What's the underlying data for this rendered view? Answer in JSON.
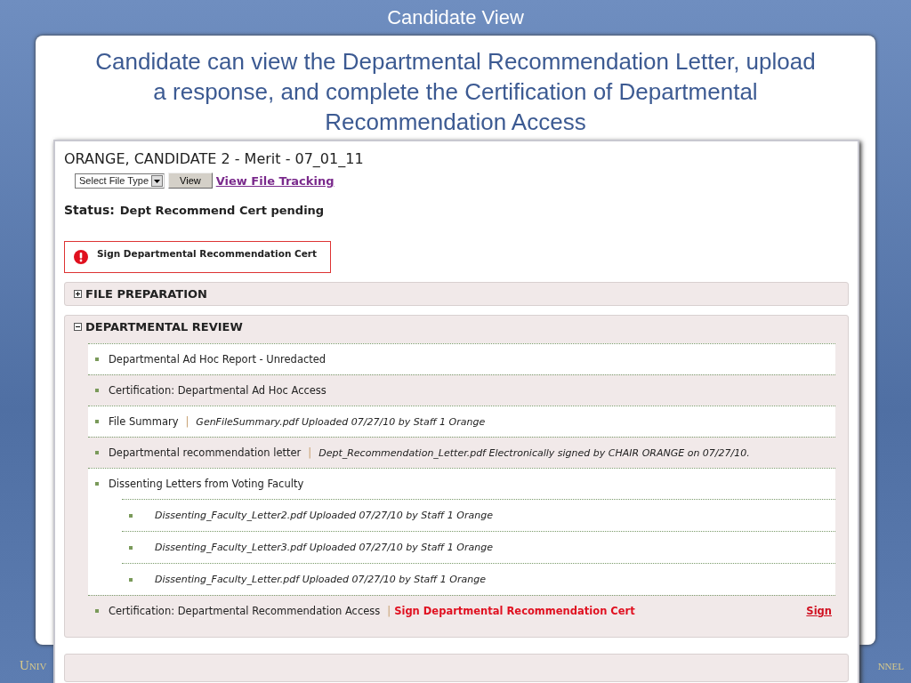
{
  "slide": {
    "title": "Candidate View",
    "heading": "Candidate can view the Departmental Recommendation Letter, upload a response, and complete the Certification of Departmental Recommendation Access",
    "footer_left": "Univ",
    "footer_right": "nnel"
  },
  "screenshot": {
    "title": "ORANGE, CANDIDATE 2 - Merit - 07_01_11",
    "file_type_select": {
      "value": "Select File Type"
    },
    "view_button": "View",
    "tracking_link": "View File Tracking",
    "status_label": "Status:",
    "status_value": "Dept Recommend Cert pending",
    "alert": "Sign Departmental Recommendation Cert",
    "sections": [
      {
        "title": "FILE PREPARATION",
        "expanded": false
      },
      {
        "title": "DEPARTMENTAL REVIEW",
        "expanded": true,
        "items": [
          {
            "label": "Departmental Ad Hoc Report - Unredacted"
          },
          {
            "label": "Certification: Departmental Ad Hoc Access"
          },
          {
            "label": "File Summary",
            "separator": "|",
            "detail": "GenFileSummary.pdf Uploaded 07/27/10 by Staff 1 Orange"
          },
          {
            "label": "Departmental recommendation letter",
            "separator": "|",
            "detail": "Dept_Recommendation_Letter.pdf Electronically signed by CHAIR ORANGE on 07/27/10."
          },
          {
            "label": "Dissenting Letters from Voting Faculty",
            "children": [
              {
                "detail": "Dissenting_Faculty_Letter2.pdf Uploaded 07/27/10 by Staff 1 Orange"
              },
              {
                "detail": "Dissenting_Faculty_Letter3.pdf Uploaded 07/27/10 by Staff 1 Orange"
              },
              {
                "detail": "Dissenting_Faculty_Letter.pdf Uploaded 07/27/10 by Staff 1 Orange"
              }
            ]
          },
          {
            "label": "Certification: Departmental Recommendation Access",
            "separator": "|",
            "action": "Sign Departmental Recommendation Cert",
            "link": "Sign"
          }
        ]
      }
    ]
  }
}
